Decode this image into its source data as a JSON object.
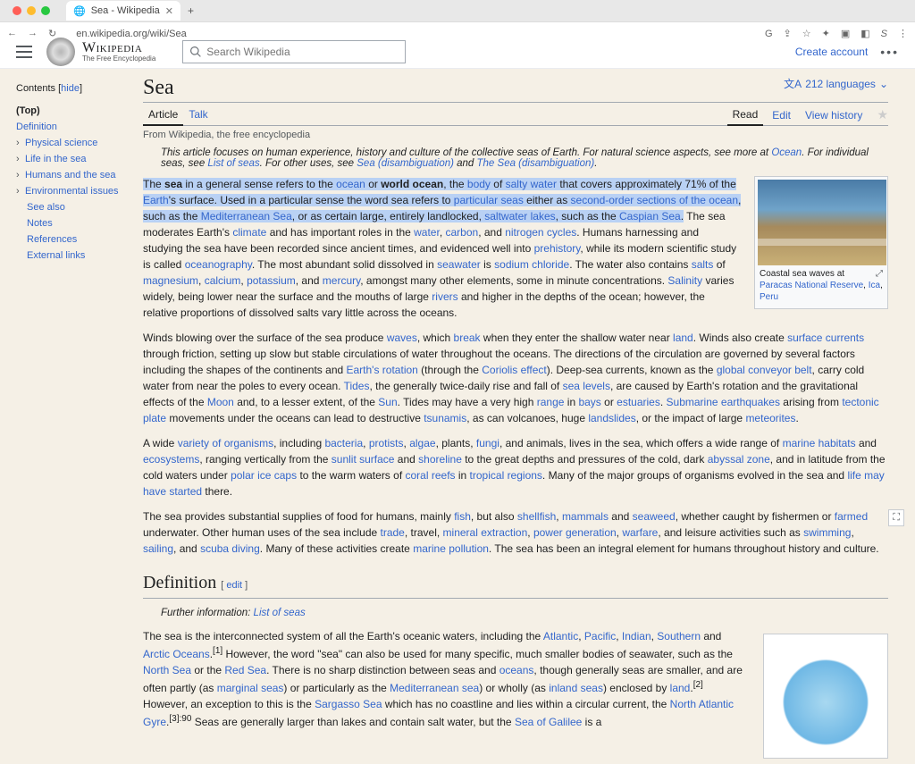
{
  "browser": {
    "tab_title": "Sea - Wikipedia",
    "url": "en.wikipedia.org/wiki/Sea"
  },
  "header": {
    "brand": "Wikipedia",
    "tagline": "The Free Encyclopedia",
    "search_placeholder": "Search Wikipedia",
    "create_account": "Create account"
  },
  "sidebar": {
    "contents_label": "Contents",
    "hide_label": "hide",
    "items": [
      {
        "label": "(Top)",
        "top": true
      },
      {
        "label": "Definition"
      },
      {
        "label": "Physical science",
        "expandable": true
      },
      {
        "label": "Life in the sea",
        "expandable": true
      },
      {
        "label": "Humans and the sea",
        "expandable": true
      },
      {
        "label": "Environmental issues",
        "expandable": true
      },
      {
        "label": "See also",
        "sub": true
      },
      {
        "label": "Notes",
        "sub": true
      },
      {
        "label": "References",
        "sub": true
      },
      {
        "label": "External links",
        "sub": true
      }
    ]
  },
  "article": {
    "title": "Sea",
    "lang_count": "212 languages",
    "tabs": {
      "article": "Article",
      "talk": "Talk",
      "read": "Read",
      "edit": "Edit",
      "history": "View history"
    },
    "subtitle": "From Wikipedia, the free encyclopedia",
    "hatnote_pre": "This article focuses on human experience, history and culture of the collective seas of Earth. For natural science aspects, see more at ",
    "hatnote_ocean": "Ocean",
    "hatnote_mid1": ". For individual seas, see ",
    "hatnote_list": "List of seas",
    "hatnote_mid2": ". For other uses, see ",
    "hatnote_disamb1": "Sea (disambiguation)",
    "hatnote_and": " and ",
    "hatnote_disamb2": "The Sea (disambiguation)",
    "infobox": {
      "cap_pre": "Coastal sea waves at ",
      "park": "Paracas National Reserve",
      "loc1": "Ica",
      "loc2": "Peru"
    },
    "p1": {
      "hl_seg": "The <b>sea</b> in a general sense refers to the <a>ocean</a> or <b>world ocean</b>, the <a>body</a> of <a>salty water</a> that covers approximately 71% of the <a>Earth</a>'s surface. Used in a particular sense the word sea refers to <a>particular seas</a> either as <a>second-order sections of the ocean</a>, such as the <a>Mediterranean Sea</a>, or as certain large, entirely landlocked, <a>saltwater lakes</a>, such as the <a>Caspian Sea</a>.",
      "rest": " The sea moderates Earth's <a>climate</a> and has important roles in the <a>water</a>, <a>carbon</a>, and <a>nitrogen cycles</a>. Humans harnessing and studying the sea have been recorded since ancient times, and evidenced well into <a>prehistory</a>, while its modern scientific study is called <a>oceanography</a>. The most abundant solid dissolved in <a>seawater</a> is <a>sodium chloride</a>. The water also contains <a>salts</a> of <a>magnesium</a>, <a>calcium</a>, <a>potassium</a>, and <a>mercury</a>, amongst many other elements, some in minute concentrations. <a>Salinity</a> varies widely, being lower near the surface and the mouths of large <a>rivers</a> and higher in the depths of the ocean; however, the relative proportions of dissolved salts vary little across the oceans."
    },
    "p2": "Winds blowing over the surface of the sea produce <a>waves</a>, which <a>break</a> when they enter the shallow water near <a>land</a>. Winds also create <a>surface currents</a> through friction, setting up slow but stable circulations of water throughout the oceans. The directions of the circulation are governed by several factors including the shapes of the continents and <a>Earth's rotation</a> (through the <a>Coriolis effect</a>). Deep-sea currents, known as the <a>global conveyor belt</a>, carry cold water from near the poles to every ocean. <a>Tides</a>, the generally twice-daily rise and fall of <a>sea levels</a>, are caused by Earth's rotation and the gravitational effects of the <a>Moon</a> and, to a lesser extent, of the <a>Sun</a>. Tides may have a very high <a>range</a> in <a>bays</a> or <a>estuaries</a>. <a>Submarine earthquakes</a> arising from <a>tectonic plate</a> movements under the oceans can lead to destructive <a>tsunamis</a>, as can volcanoes, huge <a>landslides</a>, or the impact of large <a>meteorites</a>.",
    "p3": "A wide <a>variety of organisms</a>, including <a>bacteria</a>, <a>protists</a>, <a>algae</a>, plants, <a>fungi</a>, and animals, lives in the sea, which offers a wide range of <a>marine habitats</a> and <a>ecosystems</a>, ranging vertically from the <a>sunlit surface</a> and <a>shoreline</a> to the great depths and pressures of the cold, dark <a>abyssal zone</a>, and in latitude from the cold waters under <a>polar ice caps</a> to the warm waters of <a>coral reefs</a> in <a>tropical regions</a>. Many of the major groups of organisms evolved in the sea and <a>life may have started</a> there.",
    "p4": "The sea provides substantial supplies of food for humans, mainly <a>fish</a>, but also <a>shellfish</a>, <a>mammals</a> and <a>seaweed</a>, whether caught by fishermen or <a>farmed</a> underwater. Other human uses of the sea include <a>trade</a>, travel, <a>mineral extraction</a>, <a>power generation</a>, <a>warfare</a>, and leisure activities such as <a>swimming</a>, <a>sailing</a>, and <a>scuba diving</a>. Many of these activities create <a>marine pollution</a>. The sea has been an integral element for humans throughout history and culture.",
    "def_header": "Definition",
    "edit_label": "edit",
    "further_pre": "Further information: ",
    "further_link": "List of seas",
    "p5": "The sea is the interconnected system of all the Earth's oceanic waters, including the <a>Atlantic</a>, <a>Pacific</a>, <a>Indian</a>, <a>Southern</a> and <a>Arctic Oceans</a>.<sup>[1]</sup> However, the word \"sea\" can also be used for many specific, much smaller bodies of seawater, such as the <a>North Sea</a> or the <a>Red Sea</a>. There is no sharp distinction between seas and <a>oceans</a>, though generally seas are smaller, and are often partly (as <a>marginal seas</a>) or particularly as the <a>Mediterranean sea</a>) or wholly (as <a>inland seas</a>) enclosed by <a>land</a>.<sup>[2]</sup> However, an exception to this is the <a>Sargasso Sea</a> which has no coastline and lies within a circular current, the <a>North Atlantic Gyre</a>.<sup>[3]:90</sup> Seas are generally larger than lakes and contain salt water, but the <a>Sea of Galilee</a> is a"
  }
}
